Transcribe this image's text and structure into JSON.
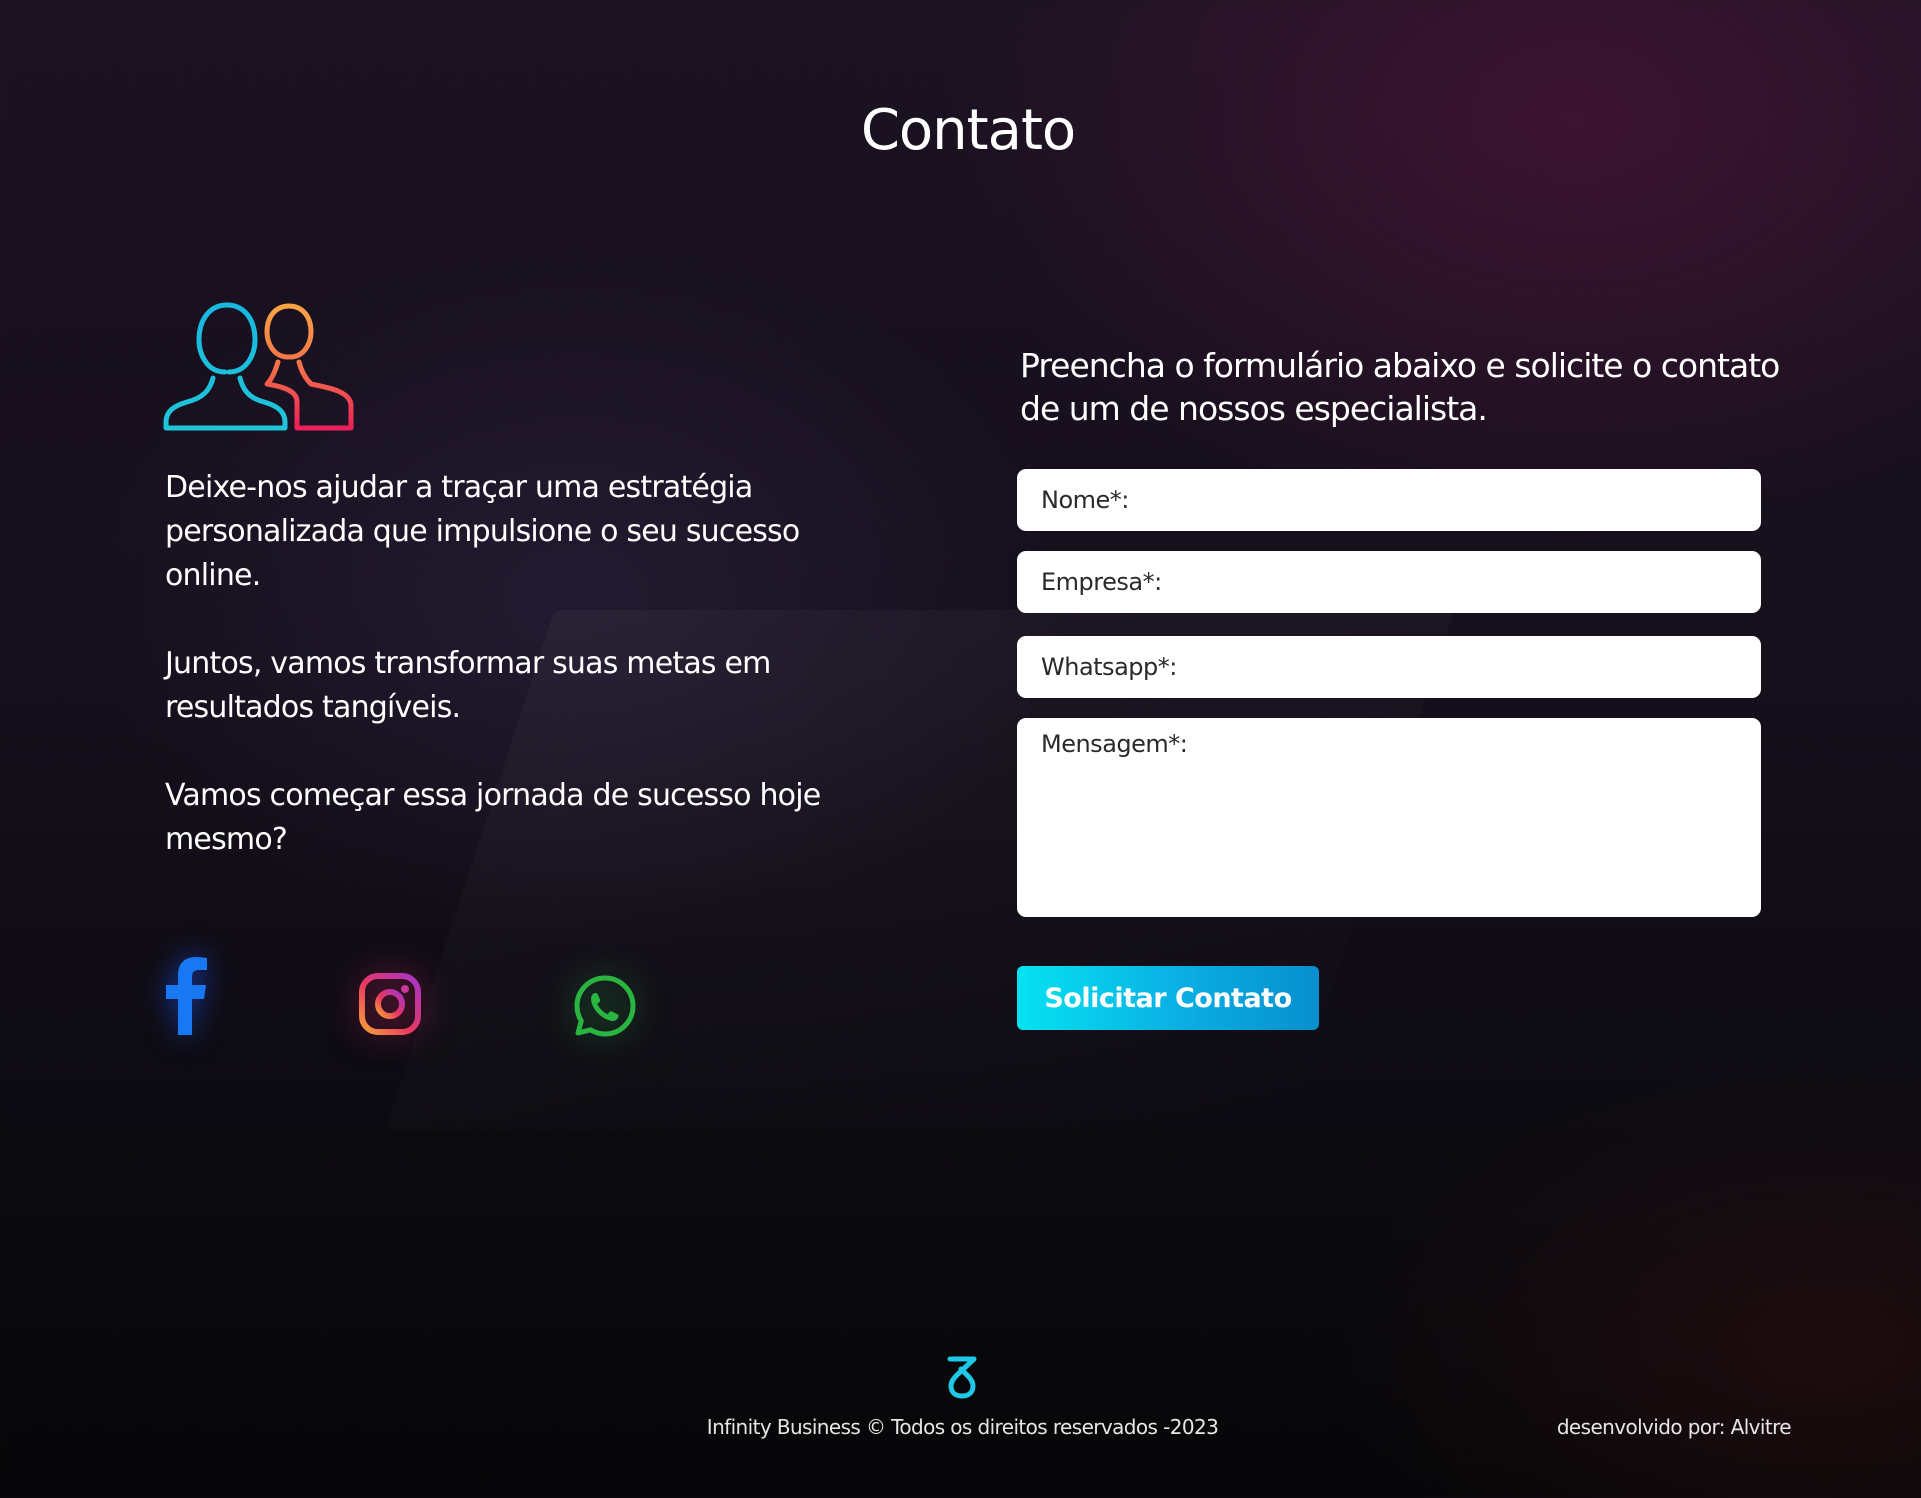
{
  "header": {
    "title": "Contato"
  },
  "intro": {
    "icon": "users-icon",
    "paragraphs": [
      "Deixe-nos ajudar a traçar uma estratégia personalizada que impulsione o seu sucesso online.",
      "Juntos, vamos transformar suas metas em resultados tangíveis.",
      "Vamos começar essa jornada de sucesso hoje mesmo?"
    ]
  },
  "socials": [
    {
      "name": "facebook-icon",
      "color": "#1877f2"
    },
    {
      "name": "instagram-icon",
      "color": "#e1306c"
    },
    {
      "name": "whatsapp-icon",
      "color": "#2ab541"
    }
  ],
  "form": {
    "intro": "Preencha o formulário abaixo e solicite o contato de um de nossos especialista.",
    "fields": {
      "nome": {
        "placeholder": "Nome*:",
        "value": ""
      },
      "empresa": {
        "placeholder": "Empresa*:",
        "value": ""
      },
      "whatsapp": {
        "placeholder": "Whatsapp*:",
        "value": ""
      },
      "mensagem": {
        "placeholder": "Mensagem*:",
        "value": ""
      }
    },
    "submit_label": "Solicitar Contato"
  },
  "footer": {
    "logo": "infinity-business-logo",
    "copyright": "Infinity Business © Todos os direitos reservados  -2023",
    "credits": "desenvolvido por: Alvitre"
  },
  "colors": {
    "accent": "#06e2f1",
    "accent_dark": "#078fcf",
    "background": "#160f1c"
  }
}
